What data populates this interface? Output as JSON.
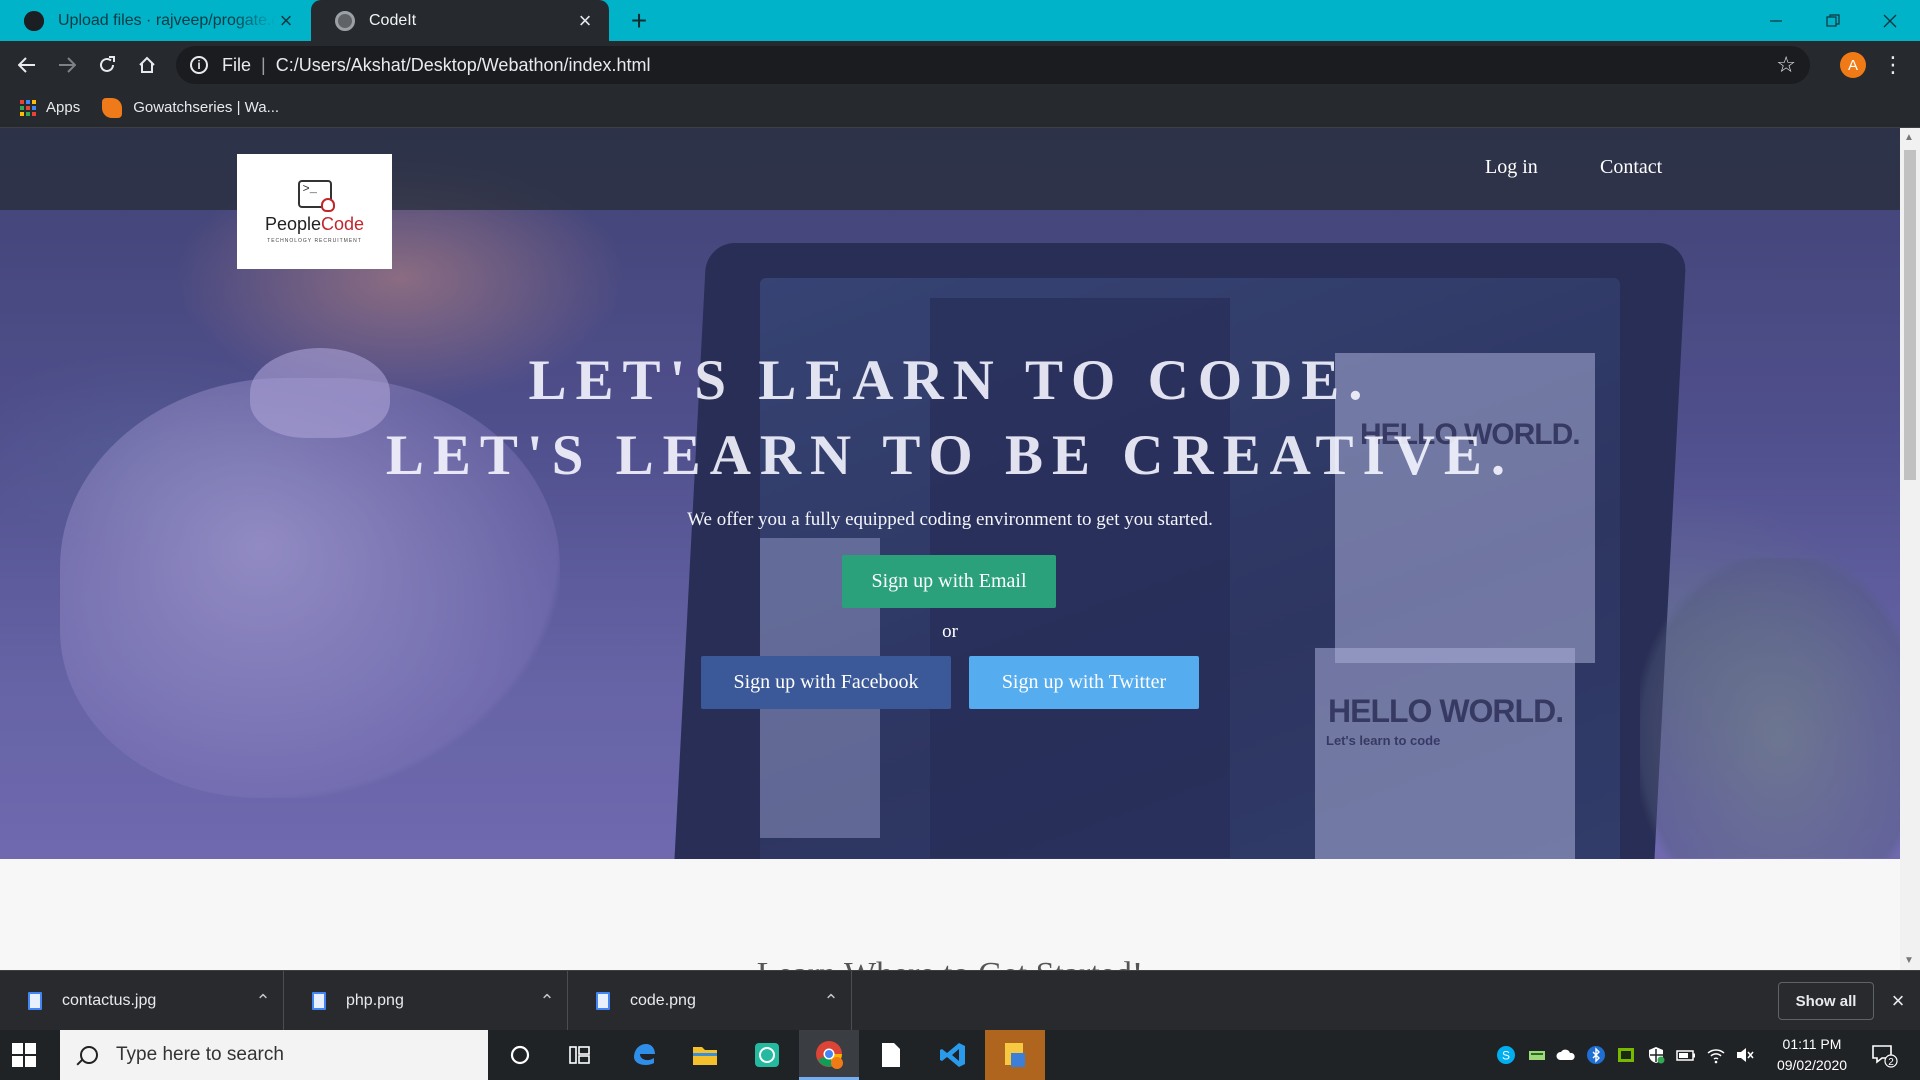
{
  "browser": {
    "tabs": [
      {
        "title": "Upload files · rajveep/progate.git",
        "active": false
      },
      {
        "title": "CodeIt",
        "active": true
      }
    ],
    "address": {
      "scheme_label": "File",
      "url": "C:/Users/Akshat/Desktop/Webathon/index.html"
    },
    "profile_initial": "A",
    "bookmarks": [
      {
        "label": "Apps",
        "icon": "apps-grid-icon"
      },
      {
        "label": "Gowatchseries | Wa...",
        "icon": "gowatchseries-icon"
      }
    ]
  },
  "page": {
    "logo": {
      "name_part1": "People",
      "name_part2": "Code",
      "subtitle": "TECHNOLOGY RECRUITMENT"
    },
    "nav": {
      "login": "Log in",
      "contact": "Contact"
    },
    "hero": {
      "headline_line1": "LET'S LEARN TO CODE.",
      "headline_line2": "LET'S LEARN TO BE CREATIVE.",
      "tagline": "We offer you a fully equipped coding environment to get you started.",
      "btn_email": "Sign up with Email",
      "or_text": "or",
      "btn_facebook": "Sign up with Facebook",
      "btn_twitter": "Sign up with Twitter",
      "screen_text_1": "HELLO WORLD.",
      "screen_text_2": "HELLO WORLD.",
      "screen_text_3": "Let's learn to code"
    },
    "next_section_heading": "Learn Where to Get Started!"
  },
  "downloads": {
    "items": [
      {
        "name": "contactus.jpg"
      },
      {
        "name": "php.png"
      },
      {
        "name": "code.png"
      }
    ],
    "show_all": "Show all"
  },
  "taskbar": {
    "search_placeholder": "Type here to search",
    "time": "01:11 PM",
    "date": "09/02/2020",
    "notification_count": "2"
  },
  "colors": {
    "chrome_tabstrip": "#00b3c8",
    "btn_email": "#2aa17b",
    "btn_facebook": "#3b5998",
    "btn_twitter": "#55acee",
    "logo_accent": "#c0262c"
  }
}
